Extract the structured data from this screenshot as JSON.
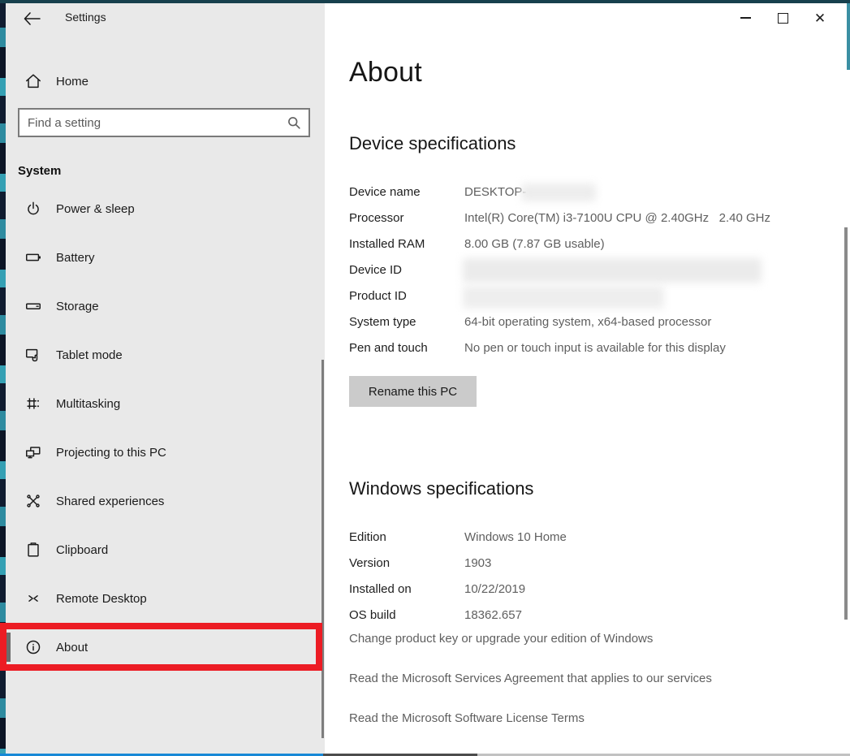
{
  "window": {
    "title": "Settings",
    "controls": {
      "minimize_icon": "minimize-icon",
      "maximize_icon": "maximize-icon",
      "close_icon": "close-icon"
    }
  },
  "sidebar": {
    "back_icon": "back-arrow-icon",
    "home": {
      "icon": "home-icon",
      "label": "Home"
    },
    "search": {
      "placeholder": "Find a setting",
      "icon": "search-icon"
    },
    "section_label": "System",
    "items": [
      {
        "icon": "power-icon",
        "label": "Power & sleep",
        "selected": false
      },
      {
        "icon": "battery-icon",
        "label": "Battery",
        "selected": false
      },
      {
        "icon": "storage-icon",
        "label": "Storage",
        "selected": false
      },
      {
        "icon": "tablet-mode-icon",
        "label": "Tablet mode",
        "selected": false
      },
      {
        "icon": "multitasking-icon",
        "label": "Multitasking",
        "selected": false
      },
      {
        "icon": "projecting-icon",
        "label": "Projecting to this PC",
        "selected": false
      },
      {
        "icon": "shared-experiences-icon",
        "label": "Shared experiences",
        "selected": false
      },
      {
        "icon": "clipboard-icon",
        "label": "Clipboard",
        "selected": false
      },
      {
        "icon": "remote-desktop-icon",
        "label": "Remote Desktop",
        "selected": false
      },
      {
        "icon": "info-icon",
        "label": "About",
        "selected": true
      }
    ]
  },
  "main": {
    "page_title": "About",
    "device_section": {
      "title": "Device specifications",
      "rows": [
        {
          "label": "Device name",
          "value": "DESKTOP-",
          "redacted": true
        },
        {
          "label": "Processor",
          "value": "Intel(R) Core(TM) i3-7100U CPU @ 2.40GHz   2.40 GHz",
          "redacted": false
        },
        {
          "label": "Installed RAM",
          "value": "8.00 GB (7.87 GB usable)",
          "redacted": false
        },
        {
          "label": "Device ID",
          "value": "",
          "redacted": true
        },
        {
          "label": "Product ID",
          "value": "",
          "redacted": true
        },
        {
          "label": "System type",
          "value": "64-bit operating system, x64-based processor",
          "redacted": false
        },
        {
          "label": "Pen and touch",
          "value": "No pen or touch input is available for this display",
          "redacted": false
        }
      ],
      "rename_button_label": "Rename this PC"
    },
    "windows_section": {
      "title": "Windows specifications",
      "rows": [
        {
          "label": "Edition",
          "value": "Windows 10 Home"
        },
        {
          "label": "Version",
          "value": "1903"
        },
        {
          "label": "Installed on",
          "value": "10/22/2019"
        },
        {
          "label": "OS build",
          "value": "18362.657"
        }
      ],
      "links": [
        {
          "label": "Change product key or upgrade your edition of Windows"
        },
        {
          "label": "Read the Microsoft Services Agreement that applies to our services"
        },
        {
          "label": "Read the Microsoft Software License Terms"
        }
      ]
    }
  },
  "annotation": {
    "color": "#ec1c24",
    "target": "About sidebar item"
  }
}
